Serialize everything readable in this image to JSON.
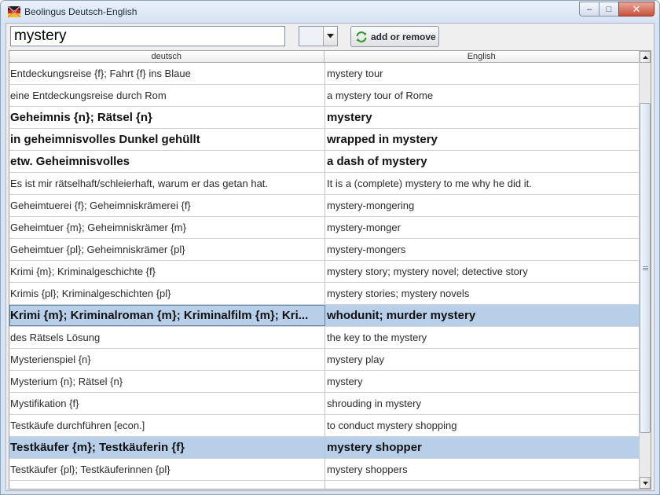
{
  "window": {
    "title": "Beolingus Deutsch-English",
    "controls": {
      "minimize": "–",
      "maximize": "□",
      "close": "✕"
    }
  },
  "toolbar": {
    "search_value": "mystery",
    "combo_value": "",
    "add_remove_label": "add or remove"
  },
  "table": {
    "headers": {
      "de": "deutsch",
      "en": "English"
    },
    "rows": [
      {
        "de": "Entdeckungsreise {f}; Fahrt {f} ins Blaue",
        "en": "mystery tour"
      },
      {
        "de": "eine Entdeckungsreise durch Rom",
        "en": "a mystery tour of Rome"
      },
      {
        "de": "Geheimnis {n}; Rätsel {n}",
        "en": "mystery"
      },
      {
        "de": "in geheimnisvolles Dunkel gehüllt",
        "en": "wrapped in mystery"
      },
      {
        "de": "etw. Geheimnisvolles",
        "en": "a dash of mystery"
      },
      {
        "de": "Es ist mir rätselhaft/schleierhaft, warum er das getan hat.",
        "en": "It is a (complete) mystery to me why he did it."
      },
      {
        "de": "Geheimtuerei {f}; Geheimniskrämerei {f}",
        "en": "mystery-mongering"
      },
      {
        "de": "Geheimtuer {m}; Geheimniskrämer {m}",
        "en": "mystery-monger"
      },
      {
        "de": "Geheimtuer {pl}; Geheimniskrämer {pl}",
        "en": "mystery-mongers"
      },
      {
        "de": "Krimi {m}; Kriminalgeschichte {f}",
        "en": "mystery story; mystery novel; detective story"
      },
      {
        "de": "Krimis {pl}; Kriminalgeschichten {pl}",
        "en": "mystery stories; mystery novels"
      },
      {
        "de": "Krimi {m}; Kriminalroman {m}; Kriminalfilm {m}; Kri...",
        "en": "whodunit; murder mystery"
      },
      {
        "de": "des Rätsels Lösung",
        "en": "the key to the mystery"
      },
      {
        "de": "Mysterienspiel {n}",
        "en": "mystery play"
      },
      {
        "de": "Mysterium {n}; Rätsel {n}",
        "en": "mystery"
      },
      {
        "de": "Mystifikation {f}",
        "en": "shrouding in mystery"
      },
      {
        "de": "Testkäufe durchführen [econ.]",
        "en": "to conduct mystery shopping"
      },
      {
        "de": "Testkäufer {m}; Testkäuferin {f}",
        "en": "mystery shopper"
      },
      {
        "de": "Testkäufer {pl}; Testkäuferinnen {pl}",
        "en": "mystery shoppers"
      },
      {
        "de": "",
        "en": ""
      }
    ]
  },
  "colors": {
    "selected_row": "#b8cfe9",
    "title_bar": "#d6e3f3",
    "close_button": "#c9513b"
  },
  "icons": {
    "app": "flag-icon",
    "add_remove": "refresh-arrows-icon",
    "combo": "triangle-down-icon",
    "scroll_up": "triangle-up-icon",
    "scroll_down": "triangle-down-icon"
  }
}
